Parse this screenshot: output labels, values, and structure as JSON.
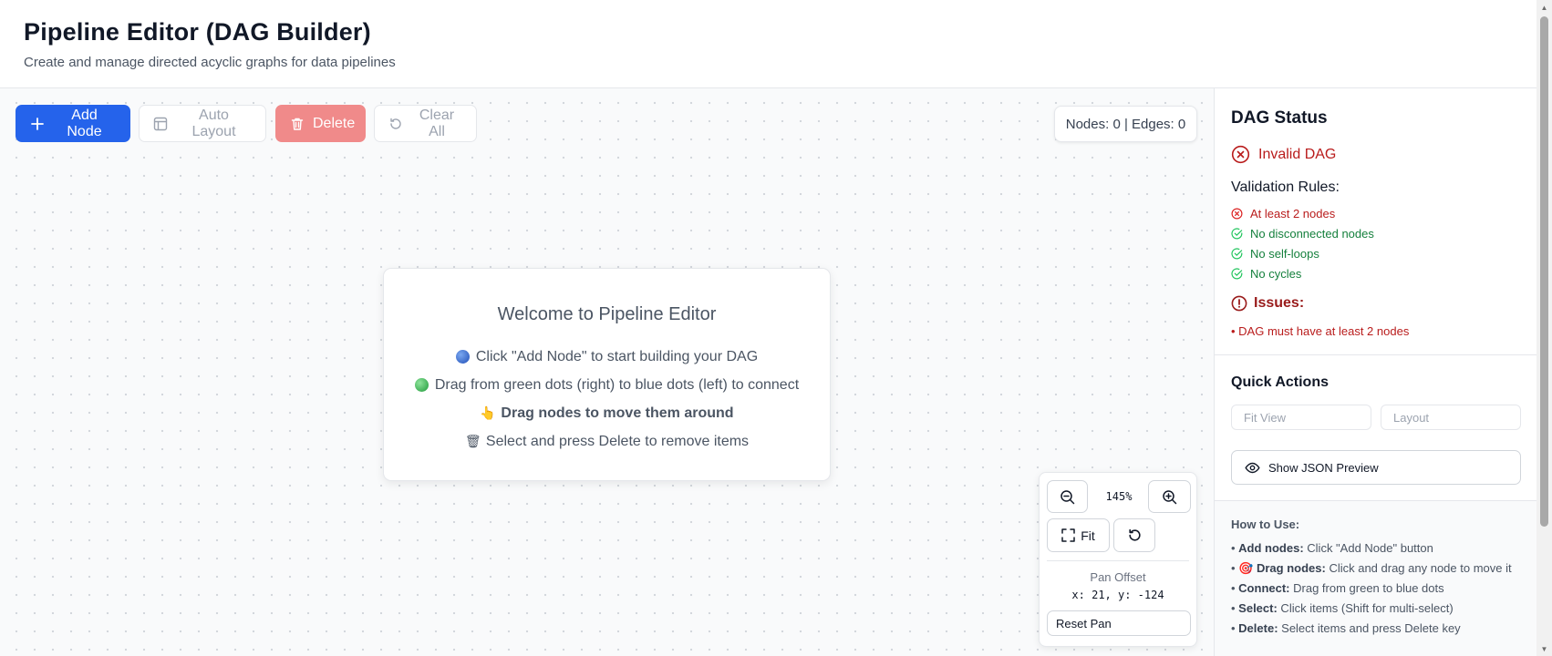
{
  "header": {
    "title": "Pipeline Editor (DAG Builder)",
    "subtitle": "Create and manage directed acyclic graphs for data pipelines"
  },
  "toolbar": {
    "add_node": "Add Node",
    "auto_layout": "Auto Layout",
    "delete": "Delete",
    "clear_all": "Clear All"
  },
  "counter": {
    "text": "Nodes: 0 | Edges: 0"
  },
  "welcome": {
    "title": "Welcome to Pipeline Editor",
    "items": [
      {
        "icon": "blue-dot-icon",
        "text": "Click \"Add Node\" to start building your DAG"
      },
      {
        "icon": "green-dot-icon",
        "text": "Drag from green dots (right) to blue dots (left) to connect"
      },
      {
        "icon": "pointing-hand-icon",
        "glyph": "👆",
        "text": "Drag nodes to move them around"
      },
      {
        "icon": "wastebasket-icon",
        "glyph": "🗑",
        "text": "Select and press Delete to remove items"
      }
    ]
  },
  "zoom": {
    "level": "145%",
    "fit_label": "Fit",
    "pan_title": "Pan Offset",
    "pan_value": "x: 21, y: -124",
    "reset_pan": "Reset Pan"
  },
  "sidebar": {
    "status_title": "DAG Status",
    "status": "Invalid DAG",
    "rules_title": "Validation Rules:",
    "rules": [
      {
        "text": "At least 2 nodes",
        "passed": false
      },
      {
        "text": "No disconnected nodes",
        "passed": true
      },
      {
        "text": "No self-loops",
        "passed": true
      },
      {
        "text": "No cycles",
        "passed": true
      }
    ],
    "issues_title": "Issues:",
    "issues": [
      "• DAG must have at least 2 nodes"
    ],
    "quick_actions_title": "Quick Actions",
    "fit_view": "Fit View",
    "layout": "Layout",
    "json_preview": "Show JSON Preview",
    "howto_title": "How to Use:",
    "howto": [
      {
        "prefix": "• ",
        "glyph": "",
        "label": "Add nodes:",
        "text": " Click \"Add Node\" button"
      },
      {
        "prefix": "• ",
        "glyph": "🎯",
        "label": "Drag nodes:",
        "text": " Click and drag any node to move it"
      },
      {
        "prefix": "• ",
        "glyph": "",
        "label": "Connect:",
        "text": " Drag from green to blue dots"
      },
      {
        "prefix": "• ",
        "glyph": "",
        "label": "Select:",
        "text": " Click items (Shift for multi-select)"
      },
      {
        "prefix": "• ",
        "glyph": "",
        "label": "Delete:",
        "text": " Select items and press Delete key"
      }
    ]
  },
  "colors": {
    "primary": "#2563eb",
    "danger": "#f08a8a",
    "error_text": "#b91c1c",
    "success_text": "#15803d"
  }
}
